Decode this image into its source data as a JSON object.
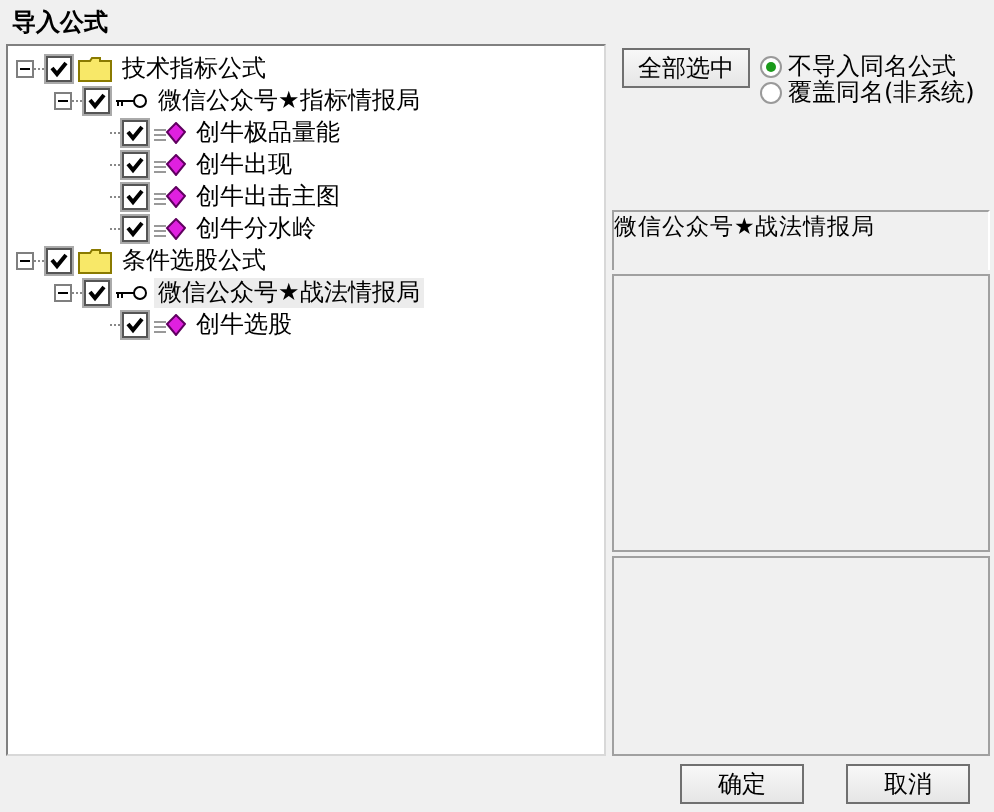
{
  "window": {
    "title": "导入公式"
  },
  "tree": [
    {
      "kind": "folder",
      "label": "技术指标公式",
      "checked": true,
      "expanded": true,
      "selected": false,
      "children": [
        {
          "kind": "group",
          "label": "微信公众号★指标情报局",
          "checked": true,
          "expanded": true,
          "selected": false,
          "children": [
            {
              "kind": "formula",
              "label": "创牛极品量能",
              "checked": true,
              "selected": false
            },
            {
              "kind": "formula",
              "label": "创牛出现",
              "checked": true,
              "selected": false
            },
            {
              "kind": "formula",
              "label": "创牛出击主图",
              "checked": true,
              "selected": false
            },
            {
              "kind": "formula",
              "label": "创牛分水岭",
              "checked": true,
              "selected": false
            }
          ]
        }
      ]
    },
    {
      "kind": "folder",
      "label": "条件选股公式",
      "checked": true,
      "expanded": true,
      "selected": false,
      "children": [
        {
          "kind": "group",
          "label": "微信公众号★战法情报局",
          "checked": true,
          "expanded": true,
          "selected": true,
          "children": [
            {
              "kind": "formula",
              "label": "创牛选股",
              "checked": true,
              "selected": false
            }
          ]
        }
      ]
    }
  ],
  "select_all_button": "全部选中",
  "options": [
    {
      "label": "不导入同名公式",
      "selected": true
    },
    {
      "label": "覆盖同名(非系统)",
      "selected": false
    }
  ],
  "detail_title": "微信公众号★战法情报局",
  "buttons": [
    "确定",
    "取消"
  ]
}
